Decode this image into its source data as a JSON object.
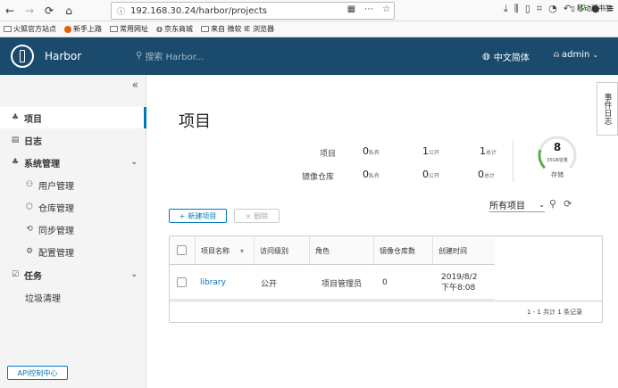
{
  "browser": {
    "url": "192.168.30.24/harbor/projects",
    "more_icon": "⋯"
  },
  "bookmarks": [
    {
      "label": "火狐官方站点",
      "icon": "folder"
    },
    {
      "label": "新手上路",
      "icon": "firefox"
    },
    {
      "label": "常用网址",
      "icon": "folder"
    },
    {
      "label": "京东商城",
      "icon": "globe"
    },
    {
      "label": "来自 微软 IE 浏览器",
      "icon": "folder"
    }
  ],
  "mobile_bookmarks": "移动版书签",
  "header": {
    "title": "Harbor",
    "search_placeholder": "搜索 Harbor...",
    "language": "中文简体",
    "user": "admin"
  },
  "sidebar": {
    "items": [
      {
        "label": "项目",
        "icon": "project-icon",
        "active": true
      },
      {
        "label": "日志",
        "icon": "log-icon"
      },
      {
        "label": "系统管理",
        "icon": "admin-icon"
      },
      {
        "label": "用户管理",
        "icon": "users-icon"
      },
      {
        "label": "仓库管理",
        "icon": "registry-icon"
      },
      {
        "label": "同步管理",
        "icon": "replication-icon"
      },
      {
        "label": "配置管理",
        "icon": "config-icon"
      },
      {
        "label": "任务",
        "icon": "task-icon"
      },
      {
        "label": "垃圾清理",
        "icon": ""
      }
    ],
    "api_button": "API控制中心"
  },
  "main": {
    "title": "项目",
    "stats": {
      "projects_label": "项目",
      "repos_label": "镜像仓库",
      "private_label": "私有",
      "public_label": "公开",
      "total_label": "总计",
      "projects_private": "0",
      "projects_public": "1",
      "projects_total": "1",
      "repos_private": "0",
      "repos_public": "0",
      "repos_total": "0"
    },
    "storage": {
      "value": "8",
      "sub": "35GB容量",
      "label": "存储",
      "fraction": 0.23
    },
    "buttons": {
      "new_project": "新建项目",
      "delete": "删除"
    },
    "filter": "所有项目",
    "table": {
      "headers": [
        "项目名称",
        "访问级别",
        "角色",
        "镜像仓库数",
        "创建时间"
      ],
      "rows": [
        {
          "name": "library",
          "access": "公开",
          "role": "项目管理员",
          "repos": "0",
          "created_line1": "2019/8/2",
          "created_line2": "下午8:08"
        }
      ],
      "footer": "1 - 1 共计 1 条记录"
    }
  },
  "event_tab": "事件日志",
  "colors": {
    "header_bg": "#1a4b6c",
    "accent": "#0079b8"
  }
}
